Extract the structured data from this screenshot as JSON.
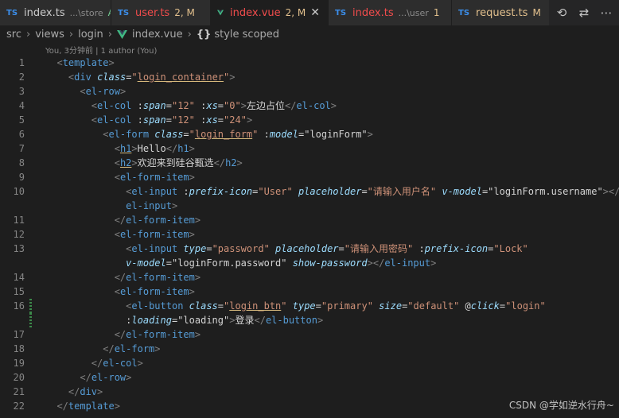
{
  "tabs": [
    {
      "icon": "typescript-icon",
      "icon_text": "TS",
      "name": "index.ts",
      "desc": "...\\store",
      "status": "A",
      "name_color": "#cccccc",
      "status_color": "#73c991",
      "active": false
    },
    {
      "icon": "typescript-icon",
      "icon_text": "TS",
      "name": "user.ts",
      "desc": "",
      "status": "2, M",
      "name_color": "#f14c4c",
      "status_color": "#e2c08d",
      "active": false
    },
    {
      "icon": "vue-icon",
      "icon_text": "",
      "name": "index.vue",
      "desc": "",
      "status": "2, M",
      "name_color": "#f14c4c",
      "status_color": "#e2c08d",
      "active": true
    },
    {
      "icon": "typescript-icon",
      "icon_text": "TS",
      "name": "index.ts",
      "desc": "...\\user",
      "status": "1",
      "name_color": "#f14c4c",
      "status_color": "#e2c08d",
      "active": false
    },
    {
      "icon": "typescript-icon",
      "icon_text": "TS",
      "name": "request.ts",
      "desc": "",
      "status": "M",
      "name_color": "#e2c08d",
      "status_color": "#e2c08d",
      "active": false
    }
  ],
  "toolbar": {
    "history_icon": "history-icon",
    "compare_icon": "git-compare-icon"
  },
  "breadcrumb": {
    "items": [
      "src",
      "views",
      "login"
    ],
    "file": "index.vue",
    "braces": "{}",
    "symbol": "style scoped"
  },
  "codelens": "You, 3分钟前 | 1 author (You)",
  "lines": [
    {
      "n": "1",
      "segs": [
        [
          "",
          "  "
        ],
        [
          "p",
          "<"
        ],
        [
          "t",
          "template"
        ],
        [
          "p",
          ">"
        ]
      ]
    },
    {
      "n": "2",
      "segs": [
        [
          "",
          "    "
        ],
        [
          "p",
          "<"
        ],
        [
          "t",
          "div"
        ],
        [
          "x",
          " "
        ],
        [
          "a",
          "class"
        ],
        [
          "x",
          "="
        ],
        [
          "s",
          "\""
        ],
        [
          "su",
          "login_container"
        ],
        [
          "s",
          "\""
        ],
        [
          "p",
          ">"
        ]
      ]
    },
    {
      "n": "3",
      "segs": [
        [
          "",
          "      "
        ],
        [
          "p",
          "<"
        ],
        [
          "t",
          "el-row"
        ],
        [
          "p",
          ">"
        ]
      ]
    },
    {
      "n": "4",
      "segs": [
        [
          "",
          "        "
        ],
        [
          "p",
          "<"
        ],
        [
          "t",
          "el-col"
        ],
        [
          "x",
          " :"
        ],
        [
          "a",
          "span"
        ],
        [
          "x",
          "="
        ],
        [
          "s",
          "\"12\""
        ],
        [
          "x",
          " :"
        ],
        [
          "a",
          "xs"
        ],
        [
          "x",
          "="
        ],
        [
          "s",
          "\"0\""
        ],
        [
          "p",
          ">"
        ],
        [
          "x",
          "左边占位"
        ],
        [
          "p",
          "</"
        ],
        [
          "t",
          "el-col"
        ],
        [
          "p",
          ">"
        ]
      ]
    },
    {
      "n": "5",
      "segs": [
        [
          "",
          "        "
        ],
        [
          "p",
          "<"
        ],
        [
          "t",
          "el-col"
        ],
        [
          "x",
          " :"
        ],
        [
          "a",
          "span"
        ],
        [
          "x",
          "="
        ],
        [
          "s",
          "\"12\""
        ],
        [
          "x",
          " :"
        ],
        [
          "a",
          "xs"
        ],
        [
          "x",
          "="
        ],
        [
          "s",
          "\"24\""
        ],
        [
          "p",
          ">"
        ]
      ]
    },
    {
      "n": "6",
      "segs": [
        [
          "",
          "          "
        ],
        [
          "p",
          "<"
        ],
        [
          "t",
          "el-form"
        ],
        [
          "x",
          " "
        ],
        [
          "a",
          "class"
        ],
        [
          "x",
          "="
        ],
        [
          "s",
          "\""
        ],
        [
          "su",
          "login_form"
        ],
        [
          "s",
          "\""
        ],
        [
          "x",
          " :"
        ],
        [
          "a",
          "model"
        ],
        [
          "x",
          "="
        ],
        [
          "x",
          "\"loginForm\""
        ],
        [
          "p",
          ">"
        ]
      ]
    },
    {
      "n": "7",
      "segs": [
        [
          "",
          "            "
        ],
        [
          "p",
          "<"
        ],
        [
          "tu",
          "h1"
        ],
        [
          "p",
          ">"
        ],
        [
          "x",
          "Hello"
        ],
        [
          "p",
          "</"
        ],
        [
          "t",
          "h1"
        ],
        [
          "p",
          ">"
        ]
      ]
    },
    {
      "n": "8",
      "segs": [
        [
          "",
          "            "
        ],
        [
          "p",
          "<"
        ],
        [
          "tu",
          "h2"
        ],
        [
          "p",
          ">"
        ],
        [
          "x",
          "欢迎来到硅谷甄选"
        ],
        [
          "p",
          "</"
        ],
        [
          "t",
          "h2"
        ],
        [
          "p",
          ">"
        ]
      ]
    },
    {
      "n": "9",
      "segs": [
        [
          "",
          "            "
        ],
        [
          "p",
          "<"
        ],
        [
          "t",
          "el-form-item"
        ],
        [
          "p",
          ">"
        ]
      ]
    },
    {
      "n": "10",
      "segs": [
        [
          "",
          "              "
        ],
        [
          "p",
          "<"
        ],
        [
          "t",
          "el-input"
        ],
        [
          "x",
          " :"
        ],
        [
          "a",
          "prefix-icon"
        ],
        [
          "x",
          "="
        ],
        [
          "s",
          "\"User\""
        ],
        [
          "x",
          " "
        ],
        [
          "a",
          "placeholder"
        ],
        [
          "x",
          "="
        ],
        [
          "s",
          "\"请输入用户名\""
        ],
        [
          "x",
          " "
        ],
        [
          "a",
          "v-model"
        ],
        [
          "x",
          "="
        ],
        [
          "x",
          "\"loginForm.username\""
        ],
        [
          "p",
          "></"
        ]
      ]
    },
    {
      "n": "",
      "segs": [
        [
          "",
          "              "
        ],
        [
          "t",
          "el-input"
        ],
        [
          "p",
          ">"
        ]
      ]
    },
    {
      "n": "11",
      "segs": [
        [
          "",
          "            "
        ],
        [
          "p",
          "</"
        ],
        [
          "t",
          "el-form-item"
        ],
        [
          "p",
          ">"
        ]
      ]
    },
    {
      "n": "12",
      "segs": [
        [
          "",
          "            "
        ],
        [
          "p",
          "<"
        ],
        [
          "t",
          "el-form-item"
        ],
        [
          "p",
          ">"
        ]
      ]
    },
    {
      "n": "13",
      "segs": [
        [
          "",
          "              "
        ],
        [
          "p",
          "<"
        ],
        [
          "t",
          "el-input"
        ],
        [
          "x",
          " "
        ],
        [
          "a",
          "type"
        ],
        [
          "x",
          "="
        ],
        [
          "s",
          "\"password\""
        ],
        [
          "x",
          " "
        ],
        [
          "a",
          "placeholder"
        ],
        [
          "x",
          "="
        ],
        [
          "s",
          "\"请输入用密码\""
        ],
        [
          "x",
          " :"
        ],
        [
          "a",
          "prefix-icon"
        ],
        [
          "x",
          "="
        ],
        [
          "s",
          "\"Lock\""
        ]
      ]
    },
    {
      "n": "",
      "segs": [
        [
          "",
          "              "
        ],
        [
          "a",
          "v-model"
        ],
        [
          "x",
          "="
        ],
        [
          "x",
          "\"loginForm.password\""
        ],
        [
          "x",
          " "
        ],
        [
          "a",
          "show-password"
        ],
        [
          "p",
          "></"
        ],
        [
          "t",
          "el-input"
        ],
        [
          "p",
          ">"
        ]
      ]
    },
    {
      "n": "14",
      "segs": [
        [
          "",
          "            "
        ],
        [
          "p",
          "</"
        ],
        [
          "t",
          "el-form-item"
        ],
        [
          "p",
          ">"
        ]
      ]
    },
    {
      "n": "15",
      "segs": [
        [
          "",
          "            "
        ],
        [
          "p",
          "<"
        ],
        [
          "t",
          "el-form-item"
        ],
        [
          "p",
          ">"
        ]
      ]
    },
    {
      "n": "16",
      "bar": true,
      "segs": [
        [
          "",
          "              "
        ],
        [
          "p",
          "<"
        ],
        [
          "t",
          "el-button"
        ],
        [
          "x",
          " "
        ],
        [
          "a",
          "class"
        ],
        [
          "x",
          "="
        ],
        [
          "s",
          "\""
        ],
        [
          "su",
          "login_btn"
        ],
        [
          "s",
          "\""
        ],
        [
          "x",
          " "
        ],
        [
          "a",
          "type"
        ],
        [
          "x",
          "="
        ],
        [
          "s",
          "\"primary\""
        ],
        [
          "x",
          " "
        ],
        [
          "a",
          "size"
        ],
        [
          "x",
          "="
        ],
        [
          "s",
          "\"default\""
        ],
        [
          "x",
          " @"
        ],
        [
          "a",
          "click"
        ],
        [
          "x",
          "="
        ],
        [
          "s",
          "\"login\""
        ]
      ]
    },
    {
      "n": "",
      "bar": true,
      "segs": [
        [
          "",
          "              "
        ],
        [
          "x",
          ":"
        ],
        [
          "a",
          "loading"
        ],
        [
          "x",
          "="
        ],
        [
          "x",
          "\"loading\""
        ],
        [
          "p",
          ">"
        ],
        [
          "x",
          "登录"
        ],
        [
          "p",
          "</"
        ],
        [
          "t",
          "el-button"
        ],
        [
          "p",
          ">"
        ]
      ]
    },
    {
      "n": "17",
      "segs": [
        [
          "",
          "            "
        ],
        [
          "p",
          "</"
        ],
        [
          "t",
          "el-form-item"
        ],
        [
          "p",
          ">"
        ]
      ]
    },
    {
      "n": "18",
      "segs": [
        [
          "",
          "          "
        ],
        [
          "p",
          "</"
        ],
        [
          "t",
          "el-form"
        ],
        [
          "p",
          ">"
        ]
      ]
    },
    {
      "n": "19",
      "segs": [
        [
          "",
          "        "
        ],
        [
          "p",
          "</"
        ],
        [
          "t",
          "el-col"
        ],
        [
          "p",
          ">"
        ]
      ]
    },
    {
      "n": "20",
      "segs": [
        [
          "",
          "      "
        ],
        [
          "p",
          "</"
        ],
        [
          "t",
          "el-row"
        ],
        [
          "p",
          ">"
        ]
      ]
    },
    {
      "n": "21",
      "segs": [
        [
          "",
          "    "
        ],
        [
          "p",
          "</"
        ],
        [
          "t",
          "div"
        ],
        [
          "p",
          ">"
        ]
      ]
    },
    {
      "n": "22",
      "segs": [
        [
          "",
          "  "
        ],
        [
          "p",
          "</"
        ],
        [
          "t",
          "template"
        ],
        [
          "p",
          ">"
        ]
      ]
    }
  ],
  "watermark": "CSDN @学如逆水行舟~"
}
